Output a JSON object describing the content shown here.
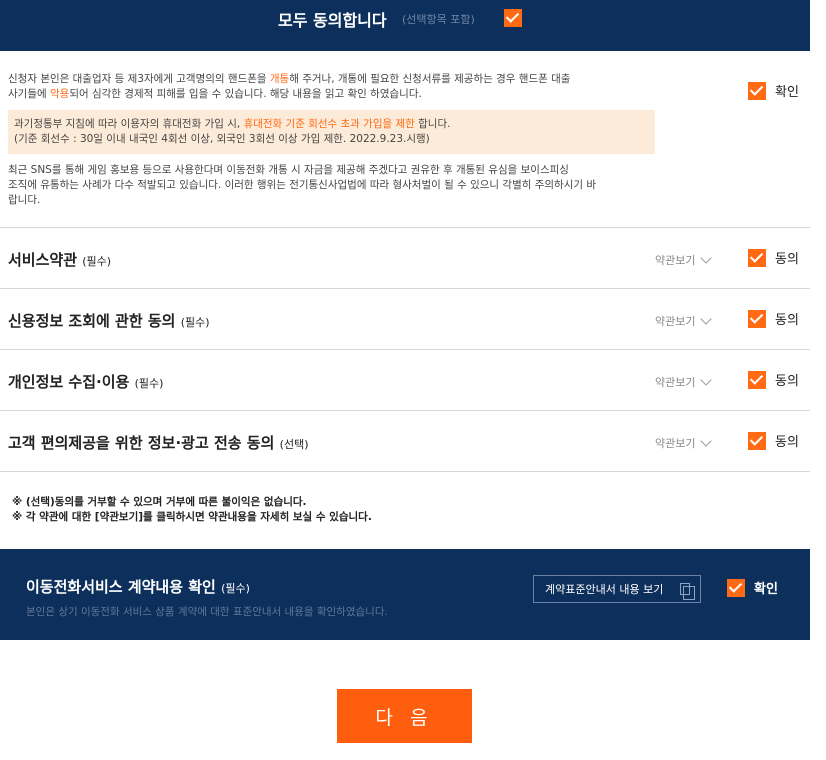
{
  "all_agree": {
    "label": "모두 동의합니다",
    "sub": "(선택항목 포함)"
  },
  "notice": {
    "line1_a": "신청자 본인은 대출업자 등 제3자에게 고객명의의 핸드폰을 ",
    "line1_hl": "개통",
    "line1_b": "해 주거나, 개통에 필요한 신청서류를 제공하는 경우 핸드폰 대출",
    "line2_a": "사기들에 ",
    "line2_hl": "악용",
    "line2_b": "되어 심각한 경제적 피해를 입을 수 있습니다. 해당 내용을 읽고 확인 하였습니다.",
    "box_a": "과기정통부 지침에 따라 이용자의 휴대전화 가입 시, ",
    "box_hl": "휴대전화 기준 회선수 초과 가입을 제한",
    "box_b": " 합니다.",
    "box_line2": "(기준 회선수 : 30일 이내 내국인 4회선 이상, 외국인 3회선 이상 가입 제한. 2022.9.23.시행)",
    "line3": "최근 SNS를 통해 게임 홍보용 등으로 사용한다며 이동전화 개통 시 자금을 제공해 주겠다고 권유한 후 개통된 유심을 보이스피싱",
    "line4": "조직에 유통하는 사례가 다수 적발되고 있습니다. 이러한 행위는 전기통신사업법에 따라 형사처벌이 될 수 있으니 각별히 주의하시기 바",
    "line5": "랍니다.",
    "confirm_label": "확인"
  },
  "terms": [
    {
      "title": "서비스약관",
      "tag": "(필수)",
      "view": "약관보기",
      "agree": "동의"
    },
    {
      "title": "신용정보 조회에 관한 동의",
      "tag": "(필수)",
      "view": "약관보기",
      "agree": "동의"
    },
    {
      "title": "개인정보 수집·이용",
      "tag": "(필수)",
      "view": "약관보기",
      "agree": "동의"
    },
    {
      "title": "고객 편의제공을 위한 정보·광고 전송 동의",
      "tag": "(선택)",
      "view": "약관보기",
      "agree": "동의"
    }
  ],
  "footnotes": [
    "※ (선택)동의를 거부할 수 있으며 거부에 따른 불이익은 없습니다.",
    "※ 각 약관에 대한 [약관보기]를 클릭하시면 약관내용을 자세히 보실 수 있습니다."
  ],
  "contract": {
    "title": "이동전화서비스 계약내용 확인",
    "tag": "(필수)",
    "desc": "본인은 상기 이동전화 서비스 상품 계약에 대한 표준안내서 내용을 확인하였습니다.",
    "doc_button": "계약표준안내서 내용 보기",
    "confirm_label": "확인"
  },
  "next_button": "다 음",
  "colors": {
    "navy": "#0d2f5c",
    "accent": "#ff6a13",
    "highlight_bg": "#fdebd9"
  },
  "icons": {
    "checkbox": "checkbox-checked-icon",
    "chevron": "chevron-down-icon",
    "copy": "copy-icon"
  }
}
